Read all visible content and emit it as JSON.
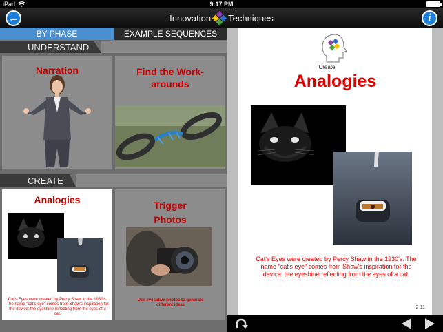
{
  "status": {
    "device": "iPad",
    "time": "9:17 PM"
  },
  "header": {
    "title_left": "Innovation",
    "title_right": "Techniques",
    "back_glyph": "←",
    "info_glyph": "i",
    "logo_colors": [
      "#8b3fa8",
      "#2f6fc9",
      "#f2c200",
      "#4aa63b"
    ]
  },
  "tabs": [
    {
      "label": "BY PHASE",
      "active": true
    },
    {
      "label": "EXAMPLE SEQUENCES",
      "active": false
    }
  ],
  "sections": {
    "understand": "UNDERSTAND",
    "create": "CREATE"
  },
  "cards": {
    "narration": {
      "title": "Narration"
    },
    "workarounds": {
      "title": "Find the Work-arounds"
    },
    "analogies": {
      "title": "Analogies",
      "caption": "Cat's Eyes were created by Percy Shaw in the 1930's. The name \"cat's eye\" comes from Shaw's inspiration for the device: the eyeshine reflecting from the eyes of a cat."
    },
    "trigger": {
      "title_1": "Trigger",
      "title_2": "Photos",
      "caption": "Use evocative photos to generate different ideas"
    }
  },
  "document": {
    "phase_label": "Create",
    "title": "Analogies",
    "caption": "Cat's Eyes were created by Percy Shaw in the 1930's. The name \"cat's eye\" comes from Shaw's inspiration for the device: the eyeshine reflecting from the eyes of a cat.",
    "page": "2-11"
  },
  "toolbar": {
    "undo_icon": "curved-arrow-icon",
    "prev_icon": "triangle-left-icon",
    "next_icon": "triangle-right-icon"
  },
  "colors": {
    "accent_blue": "#4a8fd0",
    "title_red": "#e00000"
  }
}
